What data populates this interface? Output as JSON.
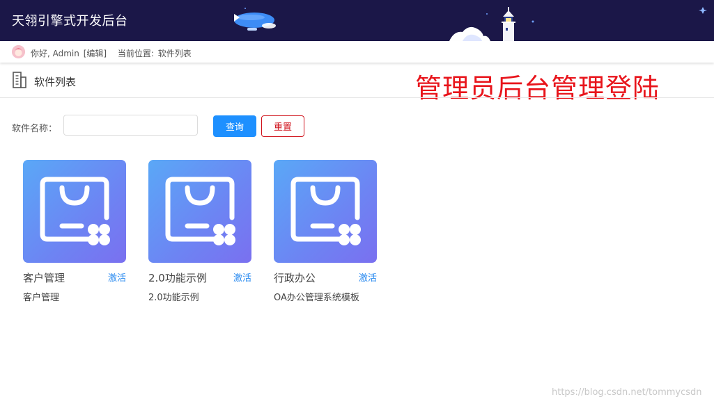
{
  "header": {
    "brand": "天翎引擎式开发后台"
  },
  "userbar": {
    "greeting": "你好, Admin",
    "edit_link": "[编辑]",
    "location_label": "当前位置:",
    "location_value": "软件列表"
  },
  "page": {
    "title": "软件列表",
    "annotation": "管理员后台管理登陆"
  },
  "search": {
    "label": "软件名称：",
    "value": "",
    "placeholder": "",
    "query_label": "查询",
    "reset_label": "重置"
  },
  "apps": [
    {
      "name": "客户管理",
      "action": "激活",
      "description": "客户管理"
    },
    {
      "name": "2.0功能示例",
      "action": "激活",
      "description": "2.0功能示例"
    },
    {
      "name": "行政办公",
      "action": "激活",
      "description": "OA办公管理系统模板"
    }
  ],
  "watermark": "https://blog.csdn.net/tommycsdn",
  "colors": {
    "topbar": "#1b1748",
    "primary": "#1e90ff",
    "danger": "#d0131c",
    "tile_start": "#5aa8f7",
    "tile_end": "#7a70f0"
  }
}
